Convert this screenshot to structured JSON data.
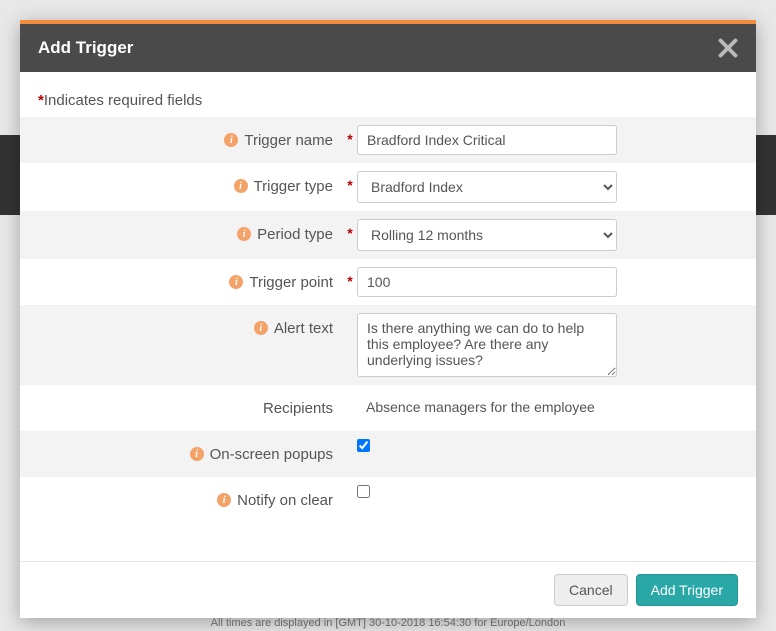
{
  "modal": {
    "title": "Add Trigger",
    "required_note": "Indicates required fields"
  },
  "fields": {
    "trigger_name": {
      "label": "Trigger name",
      "value": "Bradford Index Critical"
    },
    "trigger_type": {
      "label": "Trigger type",
      "value": "Bradford Index"
    },
    "period_type": {
      "label": "Period type",
      "value": "Rolling 12 months"
    },
    "trigger_point": {
      "label": "Trigger point",
      "value": "100"
    },
    "alert_text": {
      "label": "Alert text",
      "value": "Is there anything we can do to help this employee? Are there any underlying issues?"
    },
    "recipients": {
      "label": "Recipients",
      "value": "Absence managers for the employee"
    },
    "onscreen_popups": {
      "label": "On-screen popups"
    },
    "notify_on_clear": {
      "label": "Notify on clear"
    }
  },
  "buttons": {
    "cancel": "Cancel",
    "submit": "Add Trigger"
  },
  "footer_text": "All times are displayed in [GMT] 30-10-2018 16:54:30 for  Europe/London"
}
